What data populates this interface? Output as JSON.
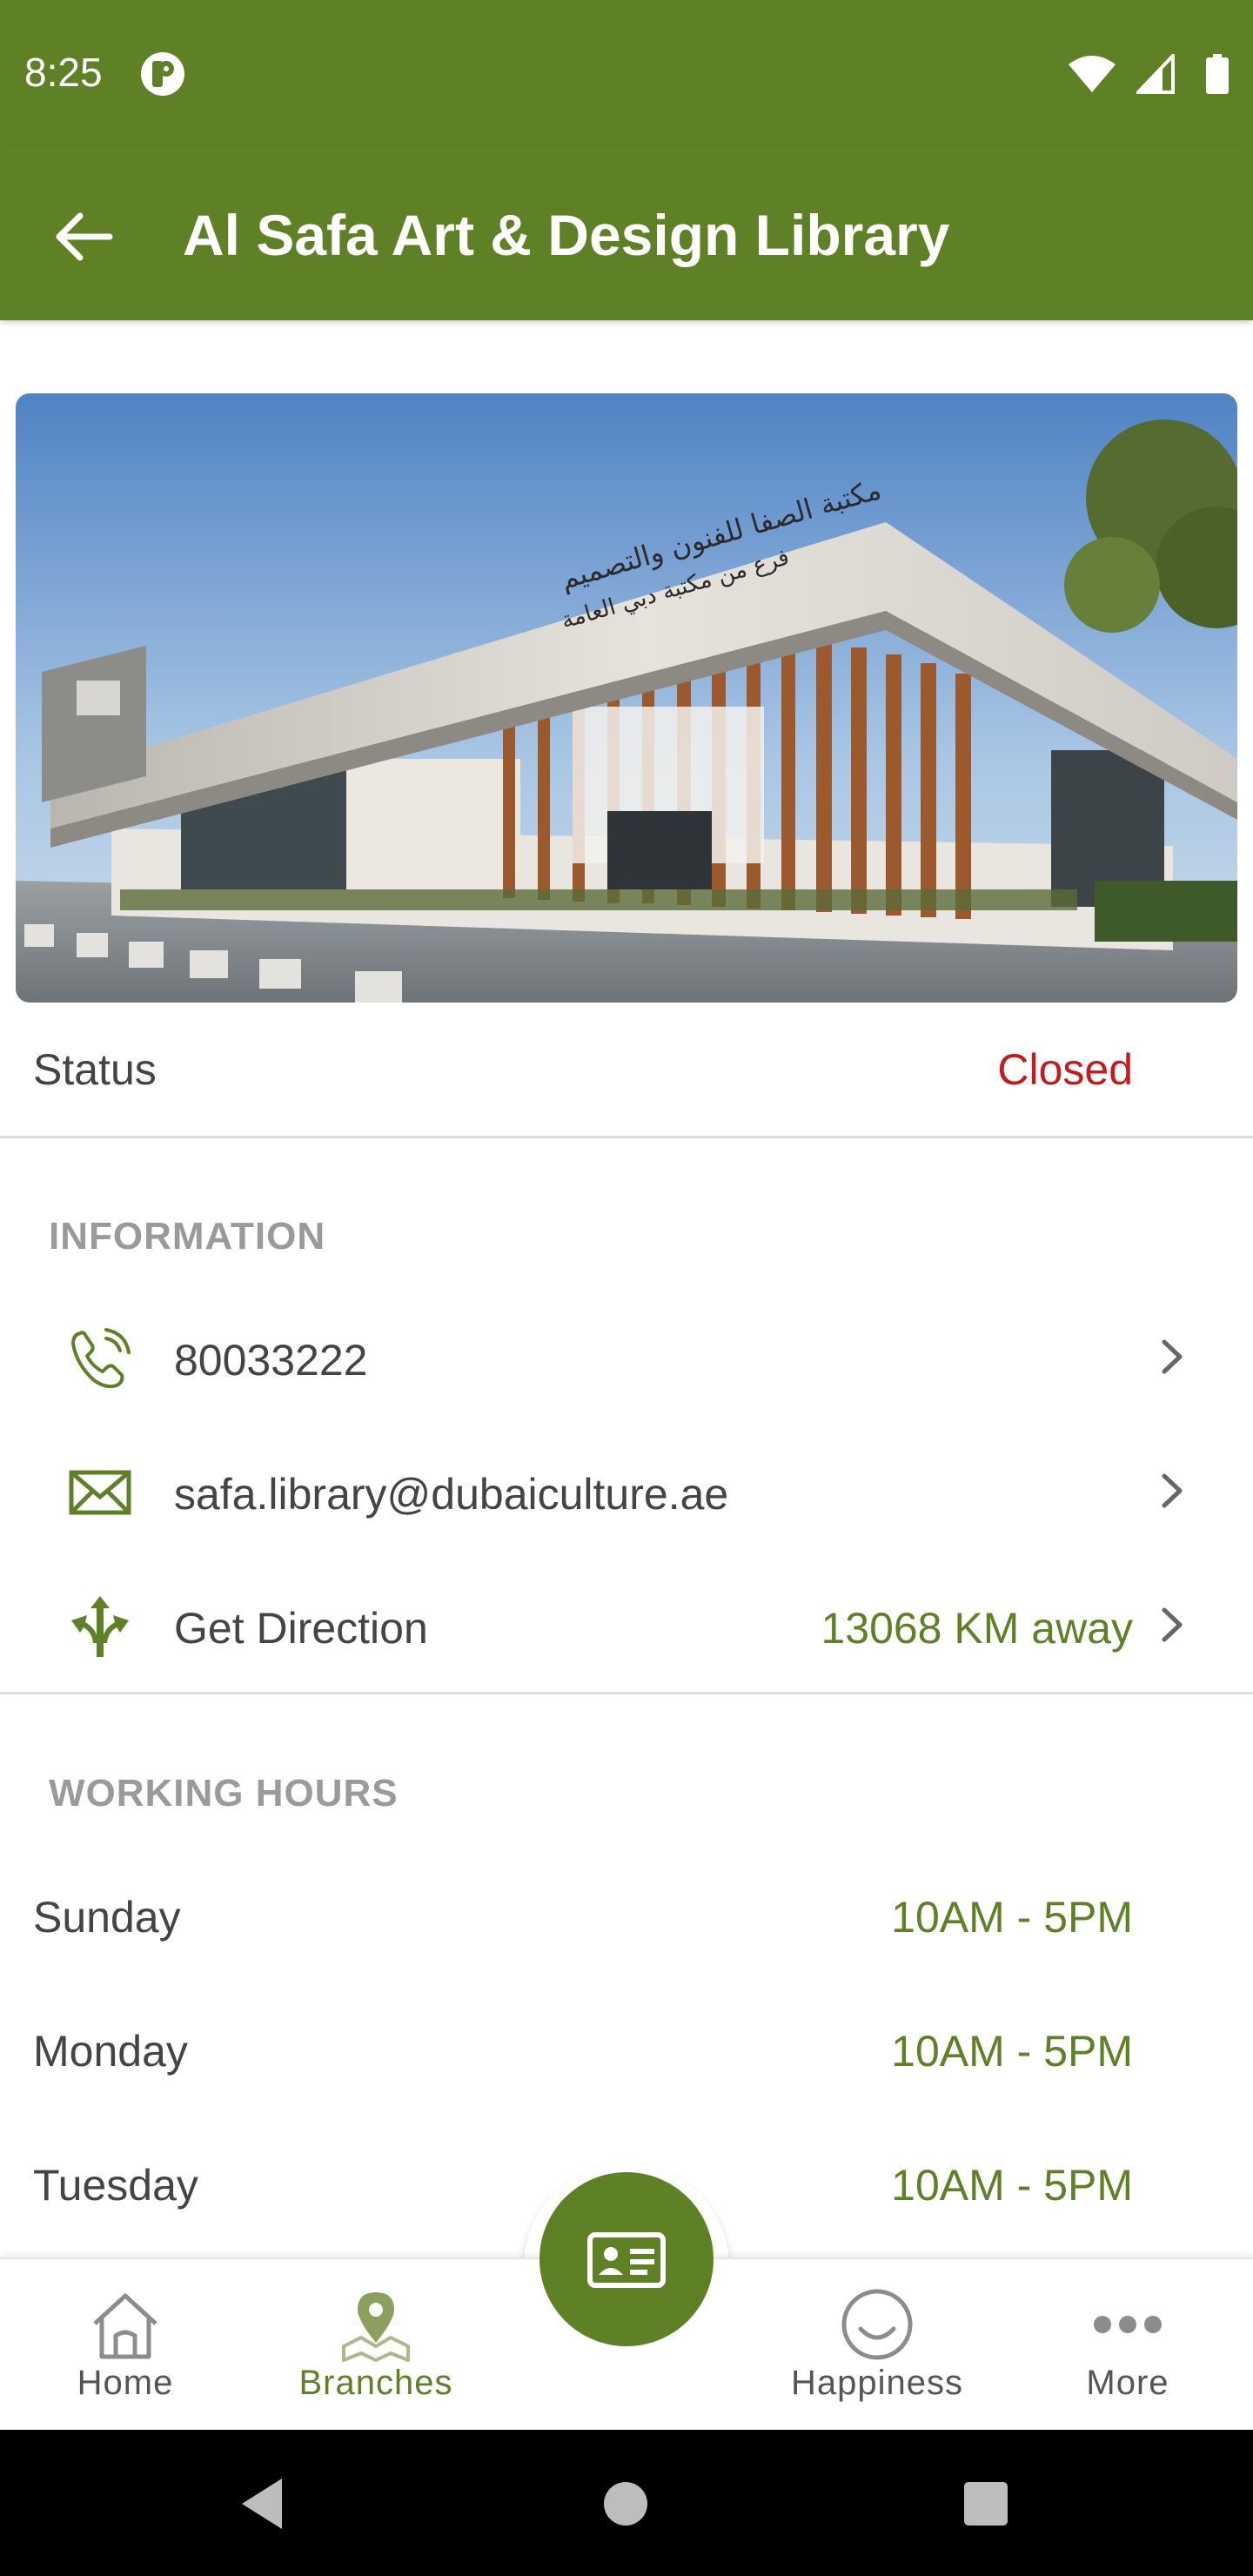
{
  "status_bar": {
    "time": "8:25"
  },
  "app_bar": {
    "title": "Al Safa Art & Design Library"
  },
  "hero": {
    "sign_line1": "مكتبة الصفا للفنون والتصميم",
    "sign_line2": "فرع من مكتبة دبي العامة"
  },
  "status": {
    "label": "Status",
    "value": "Closed",
    "value_color": "#c61a1a"
  },
  "information": {
    "header": "INFORMATION",
    "phone": "80033222",
    "email": "safa.library@dubaiculture.ae",
    "direction_label": "Get Direction",
    "direction_distance": "13068 KM away"
  },
  "working_hours": {
    "header": "WORKING HOURS",
    "days": [
      {
        "day": "Sunday",
        "hours": "10AM - 5PM"
      },
      {
        "day": "Monday",
        "hours": "10AM - 5PM"
      },
      {
        "day": "Tuesday",
        "hours": "10AM - 5PM"
      }
    ]
  },
  "bottom_nav": {
    "items": [
      {
        "label": "Home",
        "icon": "home-icon"
      },
      {
        "label": "Branches",
        "icon": "map-pin-icon",
        "active": true
      },
      {
        "label": "Happiness",
        "icon": "smiley-icon"
      },
      {
        "label": "More",
        "icon": "more-dots-icon"
      }
    ],
    "fab_icon": "id-card-icon"
  },
  "colors": {
    "primary": "#5f8125",
    "closed": "#c61a1a",
    "section_header": "#9a9a9a"
  }
}
